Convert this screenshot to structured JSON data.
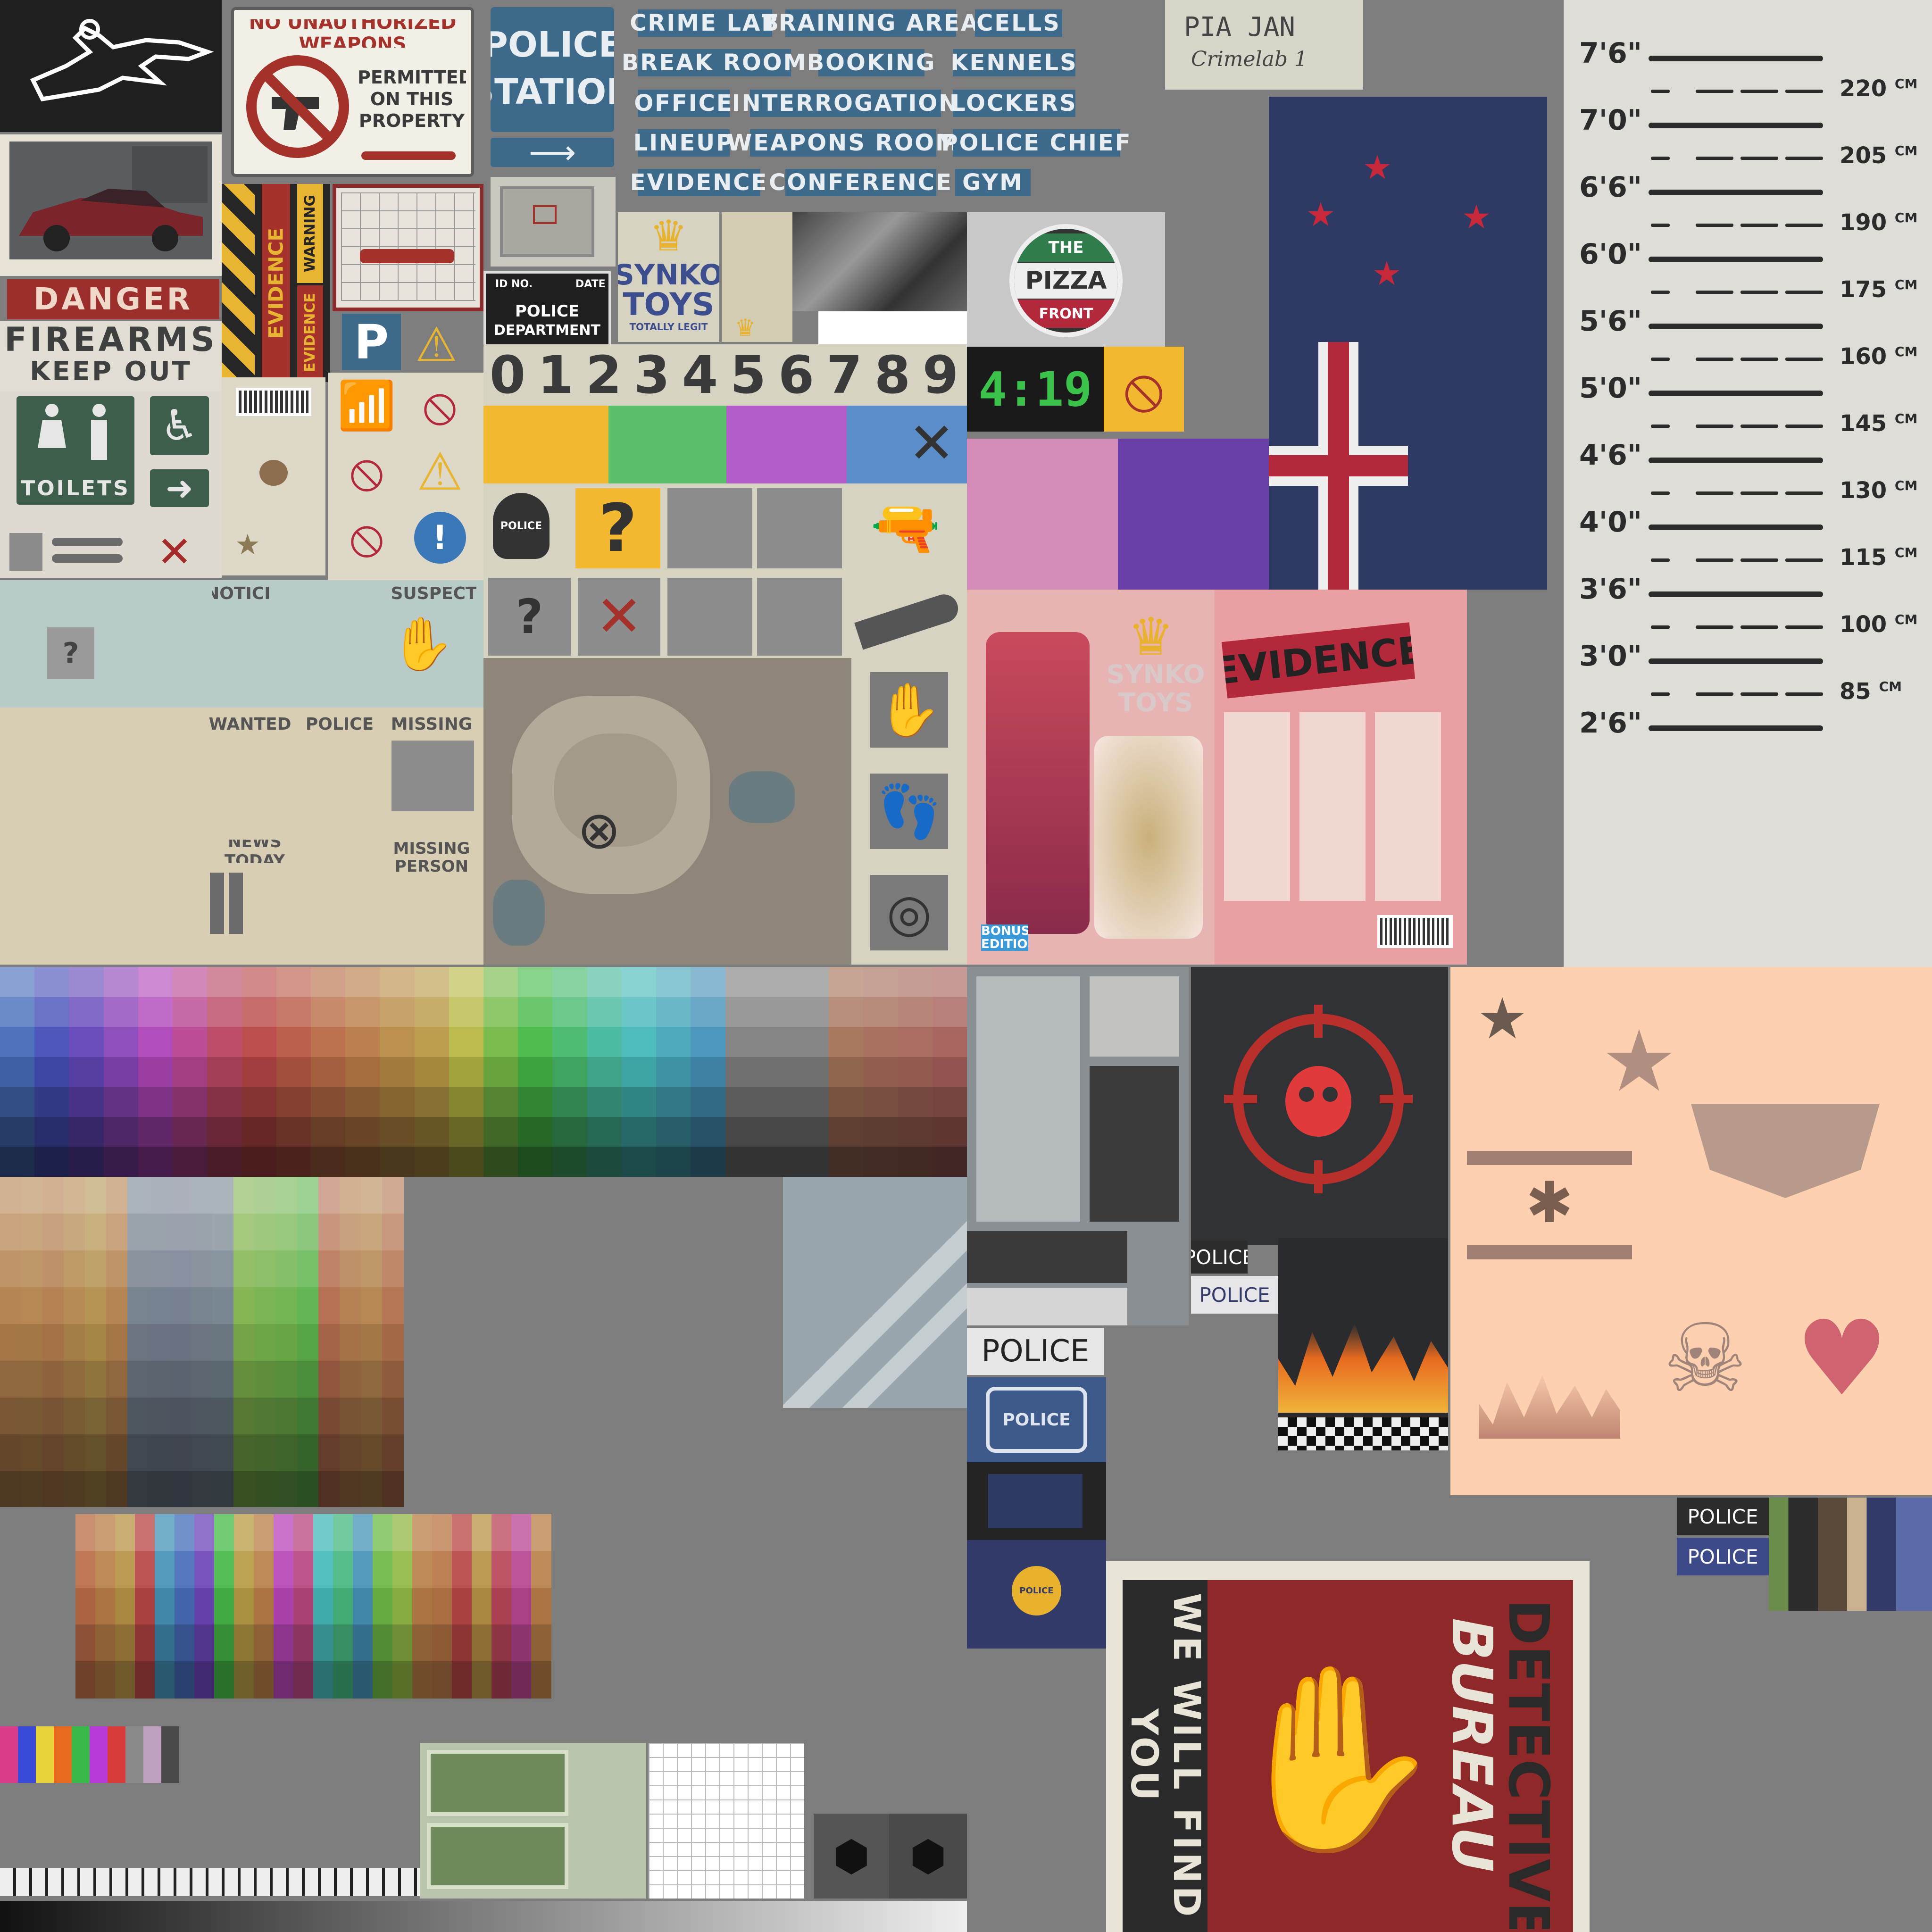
{
  "signs": {
    "no_weapons_title": "NO UNAUTHORIZED WEAPONS",
    "no_weapons_body": "PERMITTED ON THIS PROPERTY",
    "police_station_1": "POLICE",
    "police_station_2": "STATION",
    "danger": "DANGER",
    "firearms_1": "FIREARMS",
    "firearms_2": "KEEP OUT",
    "toilets": "TOILETS",
    "evidence_tape_1": "EVIDENCE",
    "evidence_tape_2": "WARNING",
    "evidence_tape_3": "EVIDENCE",
    "parking": "P",
    "id_no": "ID NO.",
    "date": "DATE",
    "police_department_1": "POLICE",
    "police_department_2": "DEPARTMENT",
    "synko_1": "SYNKO",
    "synko_2": "TOYS",
    "synko_tag": "TOTALLY LEGIT",
    "pizza_top": "THE",
    "pizza_mid": "PIZZA",
    "pizza_bottom": "FRONT",
    "clock": "4:19",
    "police_badge": "POLICE",
    "question": "?",
    "whiteboard_line1": "PIA   JAN",
    "whiteboard_line2": "Crimelab   1"
  },
  "rooms": [
    "CRIME LAB",
    "TRAINING AREA",
    "CELLS",
    "BREAK ROOM",
    "BOOKING",
    "KENNELS",
    "OFFICE",
    "INTERROGATION",
    "LOCKERS",
    "LINEUP",
    "WEAPONS ROOM",
    "POLICE CHIEF",
    "EVIDENCE",
    "CONFERENCE",
    "GYM"
  ],
  "digits": [
    "0",
    "1",
    "2",
    "3",
    "4",
    "5",
    "6",
    "7",
    "8",
    "9"
  ],
  "papers": {
    "notice": "NOTICE",
    "suspect": "SUSPECT",
    "wanted": "WANTED",
    "police": "POLICE",
    "missing": "MISSING",
    "news_today": "NEWS TODAY",
    "missing_person_1": "MISSING",
    "missing_person_2": "PERSON"
  },
  "toy_box": {
    "brand_1": "SYNKO",
    "brand_2": "TOYS",
    "evidence_label": "EVIDENCE",
    "bonus_1": "BONUS",
    "bonus_2": "EDITION"
  },
  "height_chart": {
    "feet": [
      "7'6\"",
      "7'0\"",
      "6'6\"",
      "6'0\"",
      "5'6\"",
      "5'0\"",
      "4'6\"",
      "4'0\"",
      "3'6\"",
      "3'0\"",
      "2'6\""
    ],
    "cm": [
      "220",
      "205",
      "190",
      "175",
      "160",
      "145",
      "130",
      "115",
      "100",
      "85"
    ],
    "cm_unit": "CM"
  },
  "police_labels": {
    "police_1": "POLICE",
    "police_2": "POLICE",
    "police_big": "POLICE",
    "police_badge_blue": "POLICE",
    "police_emblem": "POLICE",
    "police_3": "POLICE",
    "police_4": "POLICE"
  },
  "poster": {
    "side": "WE WILL FIND YOU",
    "title_1": "DETECTIVE",
    "title_2": "BUREAU"
  },
  "colors": {
    "room_sign": "#3d6a8a",
    "flag_blue": "#2e3a63",
    "flag_red": "#b3283a",
    "danger_red": "#9c2f2c",
    "height_bg": "#deddd7",
    "poster_red": "#8f2828",
    "pink_bg": "#fdd0b0",
    "police_navy": "#323a6a"
  },
  "icons": [
    "chalk-outline-icon",
    "sports-car-icon",
    "no-gun-icon",
    "arrow-right-icon",
    "wifi-icon",
    "no-entry-icon",
    "fire-warning-icon",
    "no-phone-icon",
    "warning-icon",
    "no-smoking-icon",
    "info-icon",
    "wheelchair-icon",
    "handprint-icon",
    "footprint-icon",
    "fingerprint-icon",
    "pistol-icon",
    "knife-icon",
    "spider-skull-icon",
    "spider-icon",
    "skull-icon",
    "heart-snake-icon",
    "star-icon",
    "crown-icon"
  ]
}
